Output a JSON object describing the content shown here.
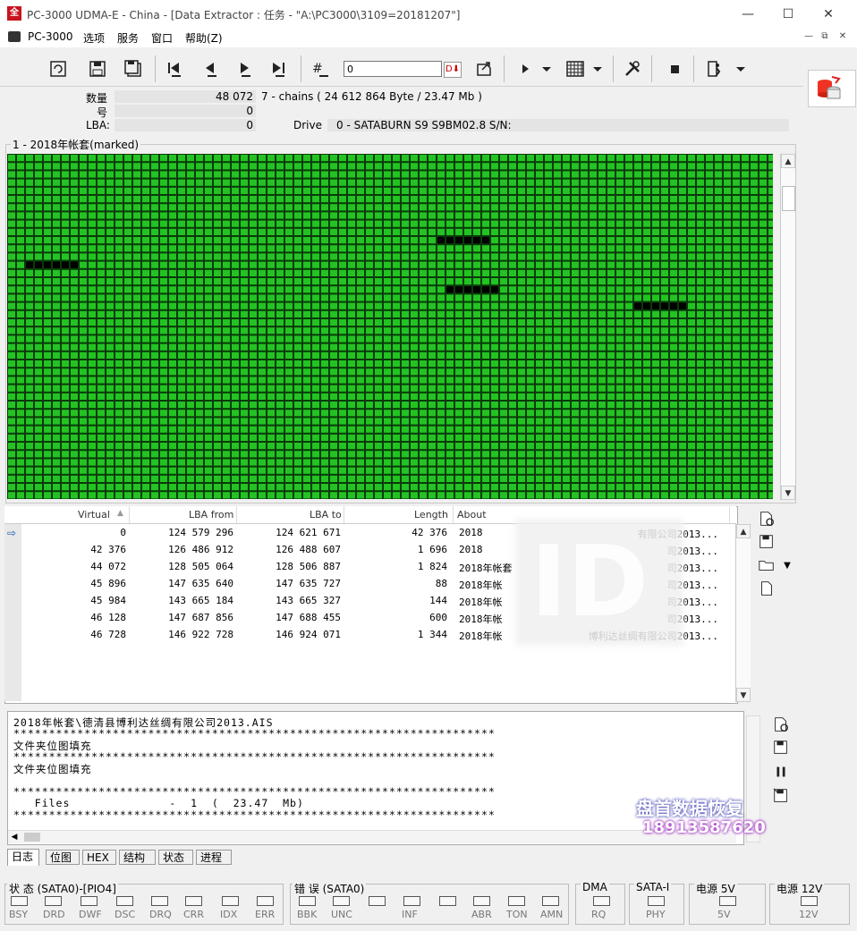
{
  "window": {
    "title": "PC-3000 UDMA-E - China - [Data Extractor : 任务 - \"A:\\PC3000\\3109=20181207\"]",
    "logo": "全",
    "minimize": "—",
    "maximize": "☐",
    "close": "✕"
  },
  "menu": {
    "items": [
      "PC-3000",
      "选项",
      "服务",
      "窗口",
      "帮助(Z)"
    ],
    "mdi": [
      "—",
      "⧉",
      "✕"
    ]
  },
  "toolbar": {
    "jump_value": "0",
    "go_label": "D⬇"
  },
  "info": {
    "count_label": "数量",
    "count_value": "48 072",
    "chains_text": "7 - chains  (  24 612 864 Byte  /  23.47 Mb )",
    "num_label": "号",
    "num_value": "0",
    "lba_label": "LBA:",
    "lba_value": "0",
    "drive_label": "Drive",
    "drive_value": "0 - SATABURN   S9  S9BM02.8  S/N:"
  },
  "map": {
    "title": "1 - 2018年帐套(marked)",
    "cols": 86,
    "rows": 42,
    "colors": {
      "ok": "#22c322",
      "bad": "#000000",
      "grid": "#0a3a0a"
    },
    "bad_runs": [
      {
        "row": 10,
        "col_start": 48,
        "length": 6
      },
      {
        "row": 13,
        "col_start": 2,
        "length": 6
      },
      {
        "row": 16,
        "col_start": 49,
        "length": 6
      },
      {
        "row": 18,
        "col_start": 70,
        "length": 6
      }
    ]
  },
  "table": {
    "headers": [
      "Virtual",
      "LBA from",
      "LBA to",
      "Length",
      "About"
    ],
    "rows": [
      {
        "virtual": "0",
        "lba_from": "124 579 296",
        "lba_to": "124 621 671",
        "length": "42 376",
        "about": "2018",
        "about_tail": "有限公司2013..."
      },
      {
        "virtual": "42 376",
        "lba_from": "126 486 912",
        "lba_to": "126 488 607",
        "length": "1 696",
        "about": "2018",
        "about_tail": "司2013..."
      },
      {
        "virtual": "44 072",
        "lba_from": "128 505 064",
        "lba_to": "128 506 887",
        "length": "1 824",
        "about": "2018年帐套",
        "about_tail": "司2013..."
      },
      {
        "virtual": "45 896",
        "lba_from": "147 635 640",
        "lba_to": "147 635 727",
        "length": "88",
        "about": "2018年帐",
        "about_tail": "司2013..."
      },
      {
        "virtual": "45 984",
        "lba_from": "143 665 184",
        "lba_to": "143 665 327",
        "length": "144",
        "about": "2018年帐",
        "about_tail": "司2013..."
      },
      {
        "virtual": "46 128",
        "lba_from": "147 687 856",
        "lba_to": "147 688 455",
        "length": "600",
        "about": "2018年帐",
        "about_tail": "司2013..."
      },
      {
        "virtual": "46 728",
        "lba_from": "146 922 728",
        "lba_to": "146 924 071",
        "length": "1 344",
        "about": "2018年帐",
        "about_tail": "博利达丝绸有限公司2013..."
      }
    ]
  },
  "log": {
    "lines": [
      "2018年帐套\\德清县博利达丝绸有限公司2013.AIS",
      "********************************************************************",
      "文件夹位图填充",
      "********************************************************************",
      "文件夹位图填充",
      "",
      "********************************************************************",
      "   Files              -  1  (  23.47  Mb)",
      "********************************************************************"
    ]
  },
  "tabs": [
    "日志",
    "位图",
    "HEX",
    "结构",
    "状态",
    "进程"
  ],
  "watermark": {
    "line1": "盘首数据恢复",
    "line2": "18913587620",
    "blur_logo": "ID"
  },
  "status": {
    "groups": [
      {
        "title": "状 态 (SATA0)-[PIO4]",
        "leds": [
          "BSY",
          "DRD",
          "DWF",
          "DSC",
          "DRQ",
          "CRR",
          "IDX",
          "ERR"
        ]
      },
      {
        "title": "错 误 (SATA0)",
        "leds": [
          "BBK",
          "UNC",
          "",
          "INF",
          "",
          "ABR",
          "TON",
          "AMN"
        ]
      },
      {
        "title": "DMA",
        "leds": [
          "RQ"
        ]
      },
      {
        "title": "SATA-I",
        "leds": [
          "PHY"
        ]
      },
      {
        "title": "电源 5V",
        "leds": [
          "5V"
        ]
      },
      {
        "title": "电源 12V",
        "leds": [
          "12V"
        ]
      }
    ]
  }
}
